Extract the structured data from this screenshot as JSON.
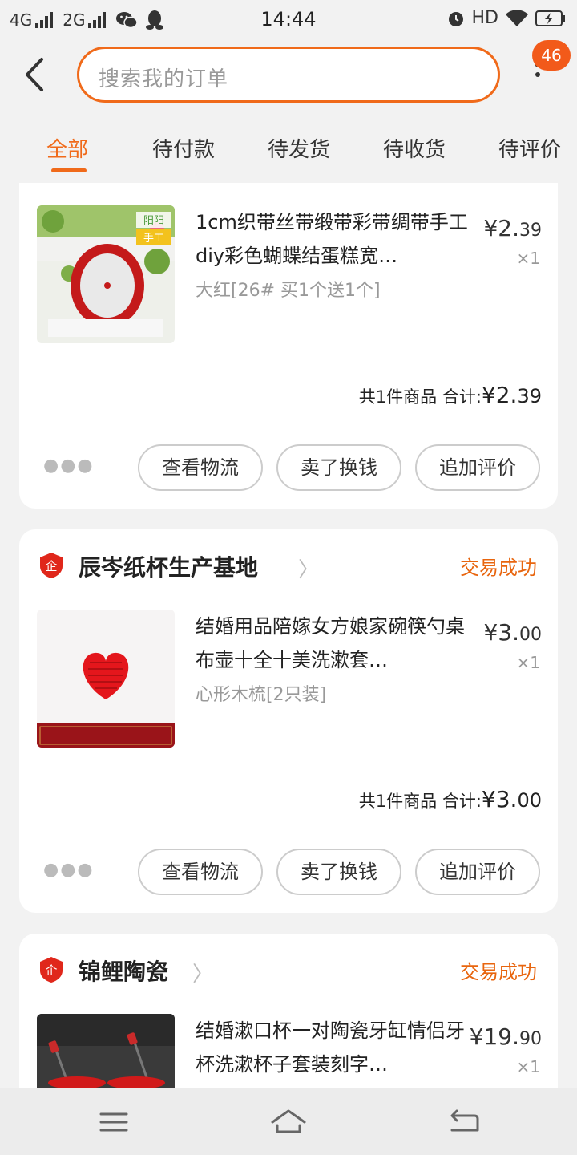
{
  "status_bar": {
    "network1": "4G",
    "network2": "2G",
    "time": "14:44",
    "hd": "HD",
    "icons": [
      "signal-icon",
      "wechat-icon",
      "qq-icon",
      "alarm-icon",
      "wifi-icon",
      "battery-charging-icon"
    ]
  },
  "header": {
    "search_placeholder": "搜索我的订单",
    "badge_count": "46"
  },
  "tabs": [
    {
      "label": "全部",
      "active": true
    },
    {
      "label": "待付款"
    },
    {
      "label": "待发货"
    },
    {
      "label": "待收货"
    },
    {
      "label": "待评价"
    }
  ],
  "orders": [
    {
      "shop": "",
      "status": "",
      "item_title": "1cm织带丝带缎带彩带绸带手工diy彩色蝴蝶结蛋糕宽…",
      "item_spec": "大红[26# 买1个送1个]",
      "thumb_label": "阳阳手工",
      "price_int": "¥2.",
      "price_dec": "39",
      "qty": "×1",
      "summary_count": "共1件商品",
      "summary_label": "合计:",
      "summary_int": "¥2.",
      "summary_dec": "39",
      "buttons": [
        "查看物流",
        "卖了换钱",
        "追加评价"
      ]
    },
    {
      "shop": "辰岑纸杯生产基地",
      "status": "交易成功",
      "item_title": "结婚用品陪嫁女方娘家碗筷勺桌布壶十全十美洗漱套…",
      "item_spec": "心形木梳[2只装]",
      "price_int": "¥3.",
      "price_dec": "00",
      "qty": "×1",
      "summary_count": "共1件商品",
      "summary_label": "合计:",
      "summary_int": "¥3.",
      "summary_dec": "00",
      "buttons": [
        "查看物流",
        "卖了换钱",
        "追加评价"
      ]
    },
    {
      "shop": "锦鲤陶瓷",
      "status": "交易成功",
      "item_title": "结婚漱口杯一对陶瓷牙缸情侣牙杯洗漱杯子套装刻字…",
      "price_int": "¥19.",
      "price_dec": "90",
      "qty": "×1"
    }
  ],
  "colors": {
    "accent": "#f06a1a",
    "status_text": "#e8650e",
    "badge": "#f25a1a"
  }
}
